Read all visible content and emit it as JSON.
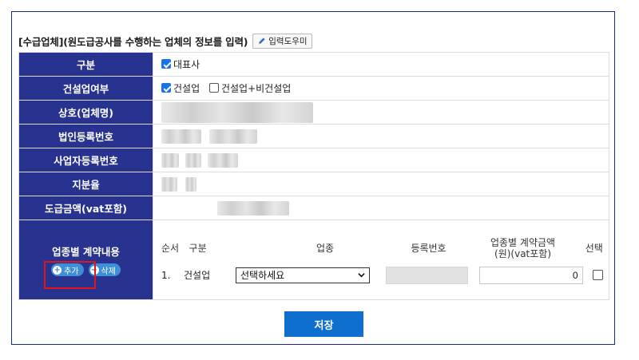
{
  "section": {
    "heading": "[수급업체](원도급공사를 수행하는 업체의 정보를 입력)",
    "help_label": "입력도우미"
  },
  "rows": {
    "category": {
      "label": "구분",
      "checkbox_label": "대표사",
      "checked": true
    },
    "construction": {
      "label": "건설업여부",
      "option1": "건설업",
      "option1_checked": true,
      "option2": "건설업+비건설업",
      "option2_checked": false
    },
    "company_name": {
      "label": "상호(업체명)"
    },
    "corp_reg_no": {
      "label": "법인등록번호"
    },
    "biz_reg_no": {
      "label": "사업자등록번호"
    },
    "share_ratio": {
      "label": "지분율"
    },
    "contract_amount": {
      "label": "도급금액(vat포함)"
    }
  },
  "contract_by_type": {
    "label": "업종별 계약내용",
    "add_label": "추가",
    "delete_label": "삭제",
    "columns": {
      "order": "순서",
      "category": "구분",
      "industry": "업종",
      "reg_no": "등록번호",
      "amount_line1": "업종별 계약금액",
      "amount_line2": "(원)(vat포함)",
      "select": "선택"
    },
    "row1": {
      "order": "1.",
      "category": "건설업",
      "industry_selected": "선택하세요",
      "amount": "0"
    }
  },
  "save_label": "저장",
  "colors": {
    "header_bg": "#27338f",
    "save_bg": "#0f6fcf",
    "highlight": "#e0141b"
  }
}
